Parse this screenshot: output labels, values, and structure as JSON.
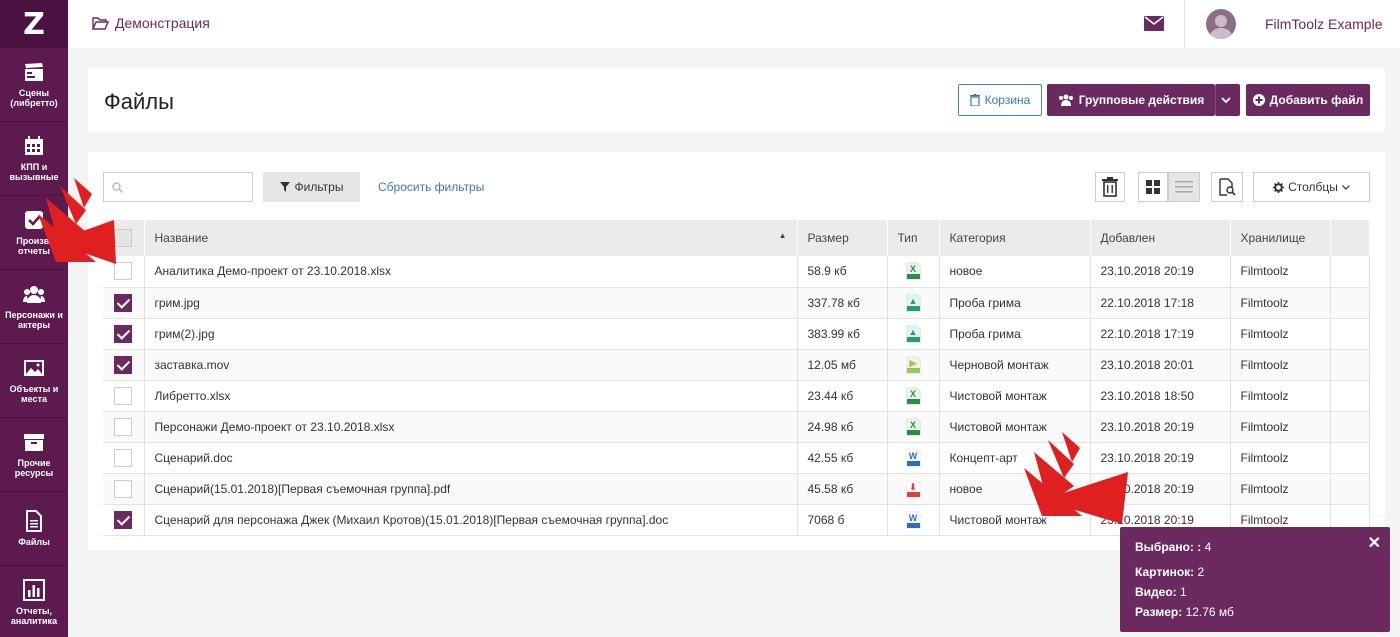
{
  "logo": "Z",
  "sidebar": {
    "items": [
      {
        "label": "Сцены (либретто)",
        "icon": "clapperboard-icon"
      },
      {
        "label": "КПП и вызывные",
        "icon": "calendar-icon"
      },
      {
        "label": "Произв. отчеты",
        "icon": "checkbox-icon"
      },
      {
        "label": "Персонажи и актеры",
        "icon": "users-icon"
      },
      {
        "label": "Объекты и места",
        "icon": "image-icon"
      },
      {
        "label": "Прочие ресурсы",
        "icon": "archive-icon"
      },
      {
        "label": "Файлы",
        "icon": "file-icon"
      },
      {
        "label": "Отчеты, аналитика",
        "icon": "bar-chart-icon"
      }
    ]
  },
  "topbar": {
    "breadcrumb": "Демонстрация",
    "user_name": "FilmToolz Example"
  },
  "header": {
    "title": "Файлы",
    "trash_label": "Корзина",
    "group_actions_label": "Групповые действия",
    "add_file_label": "Добавить файл"
  },
  "toolbar": {
    "search_placeholder": "",
    "filters_label": "Фильтры",
    "reset_filters_label": "Сбросить фильтры",
    "columns_label": "Столбцы"
  },
  "table": {
    "columns": [
      "Название",
      "Размер",
      "Тип",
      "Категория",
      "Добавлен",
      "Хранилище"
    ],
    "rows": [
      {
        "checked": false,
        "name": "Аналитика Демо-проект от 23.10.2018.xlsx",
        "size": "58.9 кб",
        "type": "xls",
        "category": "новое",
        "added": "23.10.2018 20:19",
        "storage": "Filmtoolz"
      },
      {
        "checked": true,
        "name": "грим.jpg",
        "size": "337.78 кб",
        "type": "jpg",
        "category": "Проба грима",
        "added": "22.10.2018 17:18",
        "storage": "Filmtoolz"
      },
      {
        "checked": true,
        "name": "грим(2).jpg",
        "size": "383.99 кб",
        "type": "jpg",
        "category": "Проба грима",
        "added": "22.10.2018 17:19",
        "storage": "Filmtoolz"
      },
      {
        "checked": true,
        "name": "заставка.mov",
        "size": "12.05 мб",
        "type": "mov",
        "category": "Черновой монтаж",
        "added": "23.10.2018 20:01",
        "storage": "Filmtoolz"
      },
      {
        "checked": false,
        "name": "Либретто.xlsx",
        "size": "23.44 кб",
        "type": "xls",
        "category": "Чистовой монтаж",
        "added": "23.10.2018 18:50",
        "storage": "Filmtoolz"
      },
      {
        "checked": false,
        "name": "Персонажи Демо-проект от 23.10.2018.xlsx",
        "size": "24.98 кб",
        "type": "xls",
        "category": "Чистовой монтаж",
        "added": "23.10.2018 20:19",
        "storage": "Filmtoolz"
      },
      {
        "checked": false,
        "name": "Сценарий.doc",
        "size": "42.55 кб",
        "type": "doc",
        "category": "Концепт-арт",
        "added": "23.10.2018 20:19",
        "storage": "Filmtoolz"
      },
      {
        "checked": false,
        "name": "Сценарий(15.01.2018)[Первая съемочная группа].pdf",
        "size": "45.58 кб",
        "type": "pdf",
        "category": "новое",
        "added": "23.10.2018 20:19",
        "storage": "Filmtoolz"
      },
      {
        "checked": true,
        "name": "Сценарий для персонажа Джек (Михаил Кротов)(15.01.2018)[Первая съемочная группа].doc",
        "size": "7068 б",
        "type": "doc",
        "category": "Чистовой монтаж",
        "added": "23.10.2018 20:19",
        "storage": "Filmtoolz"
      }
    ]
  },
  "selection_popup": {
    "selected_label": "Выбрано: :",
    "selected_value": "4",
    "images_label": "Картинок:",
    "images_value": "2",
    "video_label": "Видео:",
    "video_value": "1",
    "size_label": "Размер:",
    "size_value": "12.76 мб"
  },
  "colors": {
    "brand": "#6b2a5f",
    "sidebar": "#5d1a4e",
    "link": "#3a77b8",
    "arrow": "#e02020"
  }
}
